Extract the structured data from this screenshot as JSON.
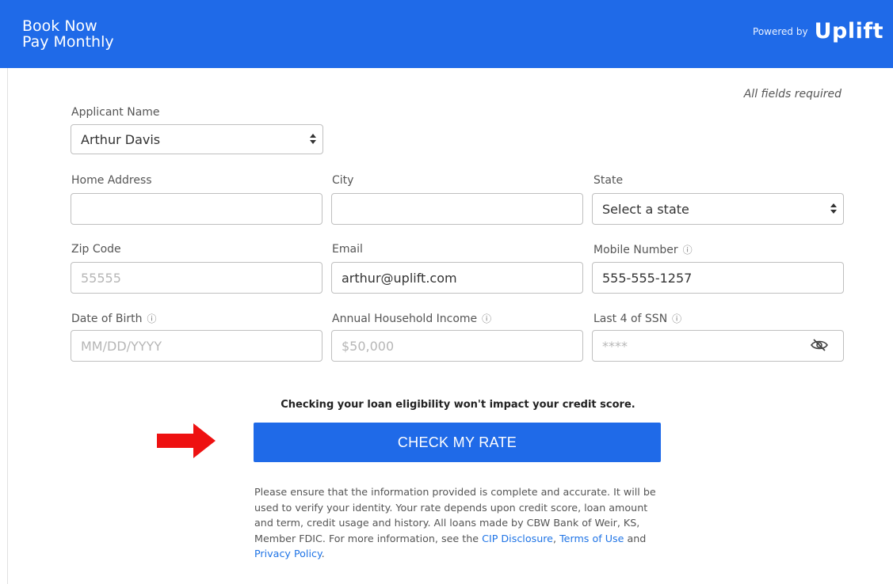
{
  "header": {
    "title_line1": "Book Now",
    "title_line2": "Pay Monthly",
    "powered_by": "Powered by",
    "logo_text": "Uplift",
    "color": "#1f6ae8"
  },
  "form": {
    "all_fields_required": "All fields required",
    "applicant_name": {
      "label": "Applicant Name",
      "value": "Arthur Davis"
    },
    "home_address": {
      "label": "Home Address",
      "value": ""
    },
    "city": {
      "label": "City",
      "value": ""
    },
    "state": {
      "label": "State",
      "value": "Select a state"
    },
    "zip_code": {
      "label": "Zip Code",
      "placeholder": "55555"
    },
    "email": {
      "label": "Email",
      "value": "arthur@uplift.com"
    },
    "mobile_number": {
      "label": "Mobile Number",
      "value": "555-555-1257"
    },
    "date_of_birth": {
      "label": "Date of Birth",
      "placeholder": "MM/DD/YYYY"
    },
    "annual_income": {
      "label": "Annual Household Income",
      "placeholder": "$50,000"
    },
    "ssn_last4": {
      "label": "Last 4 of SSN",
      "placeholder": "****"
    },
    "info_icon": "ⓘ"
  },
  "notice": "Checking your loan eligibility won't impact your credit score.",
  "cta_label": "CHECK MY RATE",
  "disclaimer": {
    "text": "Please ensure that the information provided is complete and accurate. It will be used to verify your identity. Your rate depends upon credit score, loan amount and term, credit usage and history. All loans made by CBW Bank of Weir, KS, Member FDIC. For more information, see the ",
    "link_cip": "CIP Disclosure",
    "sep": ", ",
    "link_terms": "Terms of Use",
    "and": " and ",
    "link_privacy": "Privacy Policy",
    "end": "."
  }
}
